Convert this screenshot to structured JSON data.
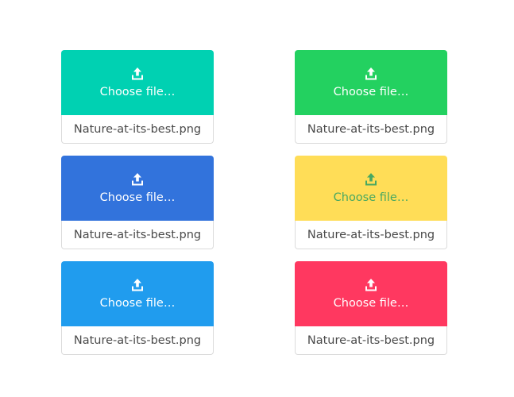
{
  "file_inputs": [
    {
      "color": "primary",
      "bg": "#00d1b2",
      "fg": "#ffffff",
      "icon": "upload-icon",
      "cta_label": "Choose file…",
      "file_name": "Nature-at-its-best.png"
    },
    {
      "color": "success",
      "bg": "#23d160",
      "fg": "#ffffff",
      "icon": "upload-icon",
      "cta_label": "Choose file…",
      "file_name": "Nature-at-its-best.png"
    },
    {
      "color": "link",
      "bg": "#3273dc",
      "fg": "#ffffff",
      "icon": "upload-icon",
      "cta_label": "Choose file…",
      "file_name": "Nature-at-its-best.png"
    },
    {
      "color": "warning",
      "bg": "#ffdd57",
      "fg": "#48a861",
      "icon": "upload-icon",
      "cta_label": "Choose file…",
      "file_name": "Nature-at-its-best.png"
    },
    {
      "color": "info",
      "bg": "#209cee",
      "fg": "#ffffff",
      "icon": "upload-icon",
      "cta_label": "Choose file…",
      "file_name": "Nature-at-its-best.png"
    },
    {
      "color": "danger",
      "bg": "#ff3860",
      "fg": "#ffffff",
      "icon": "upload-icon",
      "cta_label": "Choose file…",
      "file_name": "Nature-at-its-best.png"
    }
  ]
}
